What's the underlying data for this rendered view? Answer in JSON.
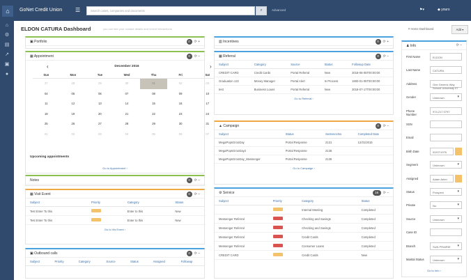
{
  "topbar": {
    "logo_icon": "home-icon",
    "app_title": "GoNet Credit Union",
    "search_placeholder": "Search cases, companies and documents",
    "advanced_label": "Advanced",
    "user_label": "◆ yours"
  },
  "sidebar": {
    "icons": [
      "home-icon",
      "gear-icon",
      "cards-icon",
      "chart-icon",
      "lock-icon",
      "user-icon"
    ]
  },
  "header": {
    "title": "ELDON CATURA Dashboard",
    "subtitle": "you can see your contact details and recent interactions",
    "breadcrumb": "# Home  Dashboard",
    "add_label": "Add ▾"
  },
  "portfolio": {
    "title": "Portfolio"
  },
  "appointment": {
    "title": "Appointment",
    "month": "December 2016",
    "days": [
      "Sun",
      "Mon",
      "Tue",
      "Wed",
      "Thu",
      "Fri",
      "Sat"
    ],
    "weeks": [
      [
        "27",
        "28",
        "29",
        "30",
        "01",
        "02",
        "03"
      ],
      [
        "04",
        "05",
        "06",
        "07",
        "08",
        "09",
        "10"
      ],
      [
        "11",
        "12",
        "13",
        "14",
        "15",
        "16",
        "17"
      ],
      [
        "18",
        "19",
        "20",
        "21",
        "22",
        "23",
        "24"
      ],
      [
        "25",
        "26",
        "27",
        "28",
        "29",
        "30",
        "31"
      ],
      [
        "01",
        "02",
        "03",
        "04",
        "05",
        "06",
        "07"
      ]
    ],
    "upcoming_label": "Upcoming appointments",
    "link": "Go to Appointment ›"
  },
  "notes": {
    "title": "Notes"
  },
  "visit": {
    "title": "Visit Event",
    "columns": [
      "Subject",
      "Priority",
      "Category",
      "Status"
    ],
    "rows": [
      [
        "Test Enter To this",
        "Normal",
        "Enter to this",
        "New"
      ],
      [
        "Test Enter To this",
        "Normal",
        "Enter to this",
        "New"
      ]
    ],
    "link": "Go to Vis Event ›"
  },
  "outbound": {
    "title": "Outbound calls",
    "columns": [
      "Subject",
      "Priority",
      "Category",
      "Source",
      "Status",
      "Assigned",
      "Followup"
    ]
  },
  "incentives": {
    "title": "Incentives"
  },
  "referral": {
    "title": "Referral",
    "columns": [
      "Subject",
      "Category",
      "Source",
      "Status",
      "Followup Date"
    ],
    "rows": [
      [
        "CREDIT CARD",
        "Credit Cards",
        "Portal Referral",
        "New",
        "2018-06-05T00:00:00"
      ],
      [
        "Graduation 122",
        "Money Manager",
        "Portal Alert",
        "In Process",
        "1900-01-05T00:00:00"
      ],
      [
        "test",
        "Business Loans",
        "Portal Referral",
        "New",
        "2018-07-17T00:00:00"
      ]
    ],
    "link": "Go to Referral ›"
  },
  "campaign": {
    "title": "Campaign",
    "columns": [
      "Subject",
      "Status",
      "SentenceNo",
      "Completed Date"
    ],
    "rows": [
      [
        "MegaPopsGrooDay",
        "Portal Response",
        "2131",
        "12/31/2015"
      ],
      [
        "MegaPopsGrooDay2",
        "Portal Response",
        "2135",
        ""
      ],
      [
        "MegaPopsGrooDay_Messenger",
        "Portal Response",
        "2135",
        ""
      ]
    ],
    "link": "Go to Campaign ›"
  },
  "service": {
    "title": "Service",
    "badge": "16",
    "columns": [
      "Subject",
      "Priority",
      "Category",
      "Status"
    ],
    "rows": [
      [
        "",
        "Normal",
        "Internal Meeting",
        "Completed"
      ],
      [
        "Messenger Referral",
        "High",
        "Checking and Savings",
        "Completed"
      ],
      [
        "Messenger Referral",
        "High",
        "Checking and Savings",
        "Completed"
      ],
      [
        "Messenger Referral",
        "High",
        "Credit Cards",
        "Completed"
      ],
      [
        "Messenger Referral",
        "High",
        "Consumer Loans",
        "Completed"
      ],
      [
        "CREDIT CARD",
        "Normal",
        "Credit Cards",
        "New"
      ]
    ]
  },
  "info": {
    "title": "Info",
    "fields": [
      {
        "label": "First Name",
        "value": "ELDON",
        "kind": "text"
      },
      {
        "label": "Last Name",
        "value": "CATURA",
        "kind": "text"
      },
      {
        "label": "Address",
        "value": "One Generic Way School University 07",
        "kind": "text"
      },
      {
        "label": "Gender",
        "value": "Unknown",
        "kind": "select"
      },
      {
        "label": "Phone Number",
        "value": "974.217.0797",
        "kind": "text"
      },
      {
        "label": "SSN",
        "value": "",
        "kind": "text"
      },
      {
        "label": "Email",
        "value": "",
        "kind": "text"
      },
      {
        "label": "Birth Date",
        "value": "02/07/1976",
        "kind": "date"
      },
      {
        "label": "Segment",
        "value": "Unknown",
        "kind": "select"
      },
      {
        "label": "Assigned",
        "value": "Adam Arlen",
        "kind": "date"
      },
      {
        "label": "Status",
        "value": "Prospect",
        "kind": "select"
      },
      {
        "label": "Private",
        "value": "No",
        "kind": "select"
      },
      {
        "label": "Source",
        "value": "Unknown",
        "kind": "select"
      },
      {
        "label": "Case ID",
        "value": "",
        "kind": "text"
      },
      {
        "label": "Branch",
        "value": "SUN PRAIRIE",
        "kind": "select"
      },
      {
        "label": "Marital Status",
        "value": "Unknown",
        "kind": "select"
      }
    ],
    "link": "Go to Info ›"
  },
  "colors": {
    "nav": "#2f4a6d",
    "green": "#8cc152",
    "orange": "#f0a844",
    "blue": "#4aa3df",
    "priority_normal": "#f4c26a",
    "priority_high": "#d9534f"
  }
}
